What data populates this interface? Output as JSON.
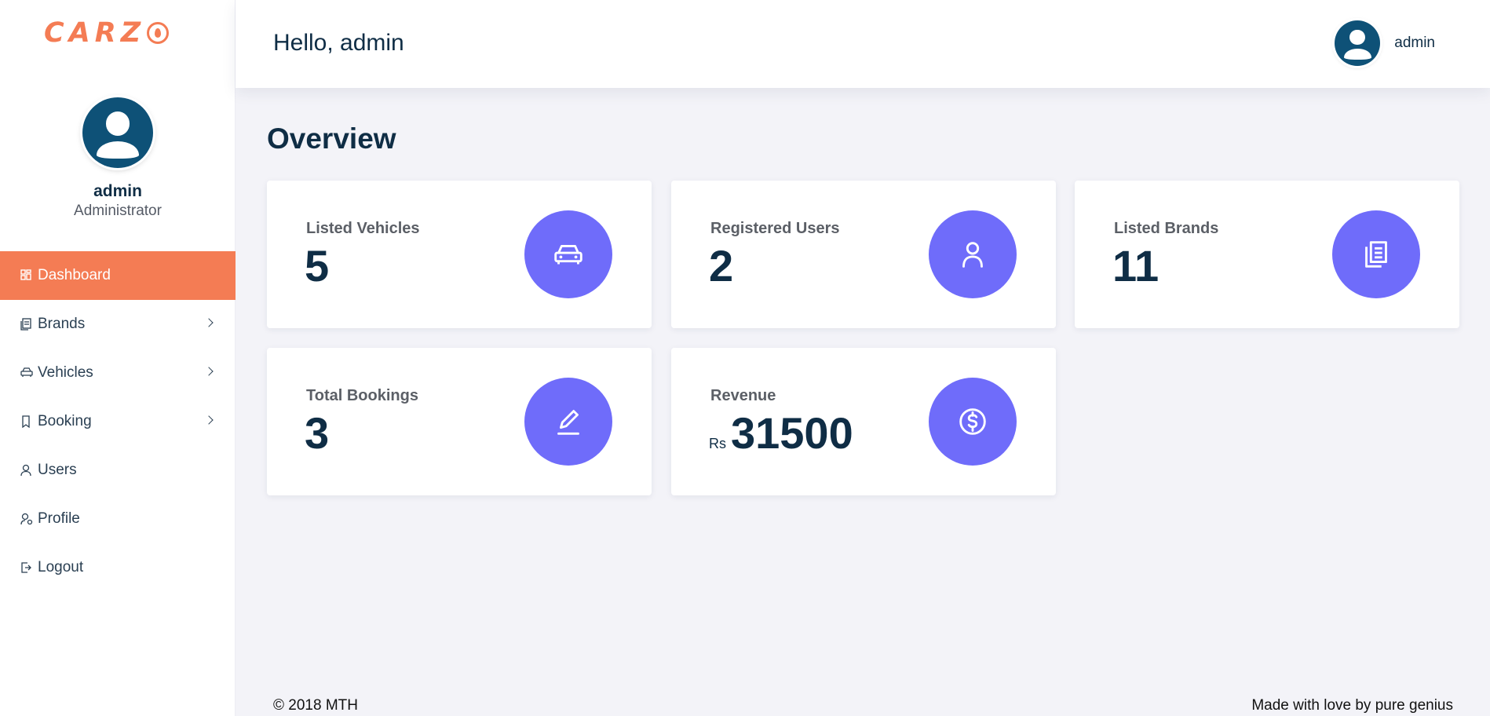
{
  "brand": {
    "logo_text": "CARZ"
  },
  "sidebar": {
    "user_name": "admin",
    "user_role": "Administrator",
    "items": [
      {
        "label": "Dashboard",
        "icon": "dashboard-icon",
        "active": true,
        "has_submenu": false
      },
      {
        "label": "Brands",
        "icon": "brands-icon",
        "active": false,
        "has_submenu": true
      },
      {
        "label": "Vehicles",
        "icon": "car-icon",
        "active": false,
        "has_submenu": true
      },
      {
        "label": "Booking",
        "icon": "bookmark-icon",
        "active": false,
        "has_submenu": true
      },
      {
        "label": "Users",
        "icon": "user-icon",
        "active": false,
        "has_submenu": false
      },
      {
        "label": "Profile",
        "icon": "user-settings-icon",
        "active": false,
        "has_submenu": false
      },
      {
        "label": "Logout",
        "icon": "logout-icon",
        "active": false,
        "has_submenu": false
      }
    ]
  },
  "header": {
    "greeting": "Hello, admin",
    "user_name": "admin"
  },
  "main": {
    "title": "Overview",
    "cards": [
      {
        "label": "Listed Vehicles",
        "value": "5",
        "prefix": "",
        "icon": "car-icon"
      },
      {
        "label": "Registered Users",
        "value": "2",
        "prefix": "",
        "icon": "user-icon"
      },
      {
        "label": "Listed Brands",
        "value": "11",
        "prefix": "",
        "icon": "documents-icon"
      },
      {
        "label": "Total Bookings",
        "value": "3",
        "prefix": "",
        "icon": "edit-icon"
      },
      {
        "label": "Revenue",
        "value": "31500",
        "prefix": "Rs",
        "icon": "dollar-icon"
      }
    ]
  },
  "footer": {
    "copyright": "© 2018 MTH",
    "credit": "Made with love by pure genius"
  },
  "colors": {
    "accent": "#f47c54",
    "card_icon_bg": "#6f6cfa",
    "heading": "#0f2d45",
    "avatar_bg": "#0e5177",
    "page_bg": "#f3f3f8"
  }
}
